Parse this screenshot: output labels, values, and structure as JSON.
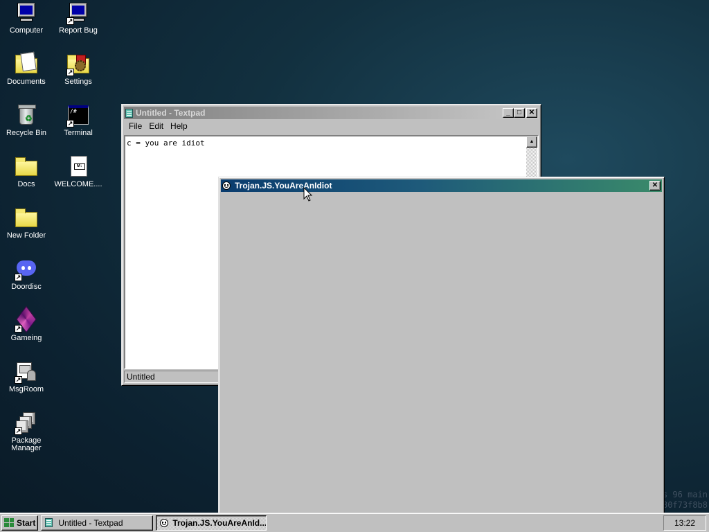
{
  "desktop": {
    "icons": [
      {
        "label": "Computer"
      },
      {
        "label": "Report Bug"
      },
      {
        "label": "Documents"
      },
      {
        "label": "Settings"
      },
      {
        "label": "Recycle Bin"
      },
      {
        "label": "Terminal"
      },
      {
        "label": "Docs"
      },
      {
        "label": "WELCOME...."
      },
      {
        "label": "New Folder"
      },
      {
        "label": "Doordisc"
      },
      {
        "label": "Gameing"
      },
      {
        "label": "MsgRoom"
      },
      {
        "label": "Package Manager"
      }
    ],
    "terminal_glyph": "/#",
    "md_badge": "M↓",
    "shortcut_glyph": "↗",
    "watermark": [
      "s 96 main",
      "80f73f8b8"
    ]
  },
  "textpad": {
    "title": "Untitled - Textpad",
    "menu": [
      "File",
      "Edit",
      "Help"
    ],
    "content": "c = you are idiot",
    "status": "Untitled",
    "btn_minimize": "_",
    "btn_maximize": "□",
    "btn_close": "✕",
    "scroll_up": "▲"
  },
  "trojan": {
    "title": "Trojan.JS.YouAreAnIdiot",
    "btn_close": "✕"
  },
  "taskbar": {
    "start_label": "Start",
    "tasks": [
      "Untitled - Textpad",
      "Trojan.JS.YouAreAnId..."
    ],
    "clock": "13:22"
  },
  "colors": {
    "active_title_start": "#0a3c6e",
    "active_title_end": "#3a8a6a",
    "window_face": "#c0c0c0"
  }
}
